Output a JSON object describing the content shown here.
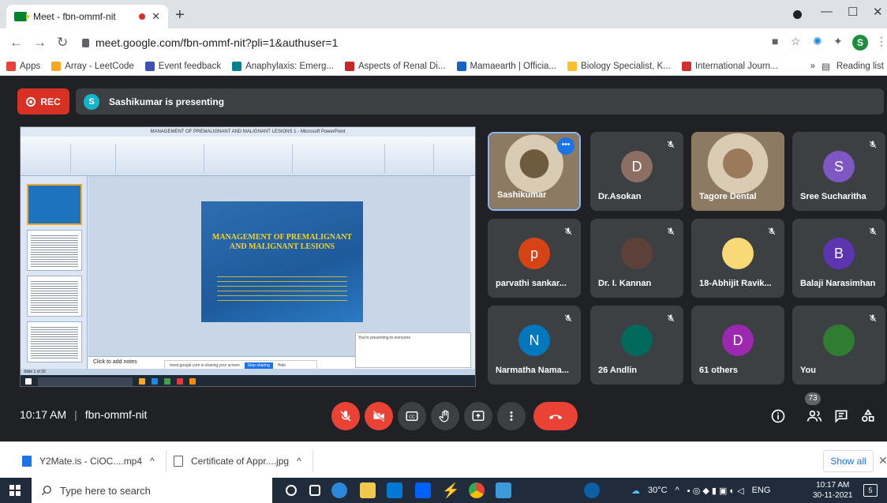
{
  "browser": {
    "tab_title": "Meet - fbn-ommf-nit",
    "url": "meet.google.com/fbn-ommf-nit?pli=1&authuser=1",
    "profile_initial": "S",
    "bookmarks": [
      {
        "label": "Apps",
        "color": "#ea4335"
      },
      {
        "label": "Array - LeetCode",
        "color": "#f9a825"
      },
      {
        "label": "Event feedback",
        "color": "#3f51b5"
      },
      {
        "label": "Anaphylaxis: Emerg...",
        "color": "#00838f"
      },
      {
        "label": "Aspects of Renal Di...",
        "color": "#c62828"
      },
      {
        "label": "Mamaearth | Officia...",
        "color": "#1565c0"
      },
      {
        "label": "Biology Specialist, K...",
        "color": "#fbc02d"
      },
      {
        "label": "International Journ...",
        "color": "#d32f2f"
      }
    ],
    "reading_list": "Reading list",
    "bookmarks_overflow": "»"
  },
  "meet": {
    "rec_label": "REC",
    "presenter_initial": "S",
    "presenting_text": "Sashikumar is presenting",
    "time": "10:17 AM",
    "separator": "|",
    "meeting_code": "fbn-ommf-nit",
    "people_count": "73"
  },
  "presentation": {
    "window_title": "MANAGEMENT OF PREMALIGNANT AND MALIGNANT LESIONS 1 - Microsoft PowerPoint",
    "slide_title": "MANAGEMENT OF PREMALIGNANT AND MALIGNANT LESIONS",
    "notes_placeholder": "Click to add notes",
    "share_bar_text": "meet.google.com is sharing your screen",
    "stop_sharing": "Stop sharing",
    "hide": "Hide",
    "notif_text": "You're presenting to everyone",
    "status_text": "Slide 1 of 32"
  },
  "participants": [
    {
      "name": "Sashikumar",
      "initial": "",
      "color": "#6d5a3f",
      "muted": false,
      "video": true,
      "active": true
    },
    {
      "name": "Dr.Asokan",
      "initial": "D",
      "color": "#8d6e63",
      "muted": true,
      "video": false,
      "active": false
    },
    {
      "name": "Tagore Dental",
      "initial": "",
      "color": "#9a7a5a",
      "muted": false,
      "video": true,
      "active": false
    },
    {
      "name": "Sree Sucharitha",
      "initial": "S",
      "color": "#7e57c2",
      "muted": true,
      "video": false,
      "active": false
    },
    {
      "name": "parvathi sankar...",
      "initial": "p",
      "color": "#d84315",
      "muted": true,
      "video": false,
      "active": false
    },
    {
      "name": "Dr. I. Kannan",
      "initial": "",
      "color": "#5d4037",
      "muted": true,
      "video": false,
      "active": false
    },
    {
      "name": "18-Abhijit Ravik...",
      "initial": "",
      "color": "#f9d976",
      "muted": true,
      "video": false,
      "active": false
    },
    {
      "name": "Balaji Narasimhan",
      "initial": "B",
      "color": "#5e35b1",
      "muted": true,
      "video": false,
      "active": false
    },
    {
      "name": "Narmatha Nama...",
      "initial": "N",
      "color": "#0277bd",
      "muted": true,
      "video": false,
      "active": false
    },
    {
      "name": "26 Andlin",
      "initial": "",
      "color": "#00695c",
      "muted": true,
      "video": false,
      "active": false
    },
    {
      "name": "61 others",
      "initial": "D",
      "color": "#9c27b0",
      "muted": false,
      "video": false,
      "active": false
    },
    {
      "name": "You",
      "initial": "",
      "color": "#2e7d32",
      "muted": true,
      "video": false,
      "active": false
    }
  ],
  "downloads": [
    {
      "name": "Y2Mate.is - CiOC....mp4",
      "caret": "^"
    },
    {
      "name": "Certificate of Appr....jpg",
      "caret": "^"
    }
  ],
  "show_all": "Show all",
  "taskbar": {
    "search_placeholder": "Type here to search",
    "temperature": "30°C",
    "language": "ENG",
    "clock_time": "10:17 AM",
    "clock_date": "30-11-2021",
    "notif_count": "5"
  }
}
